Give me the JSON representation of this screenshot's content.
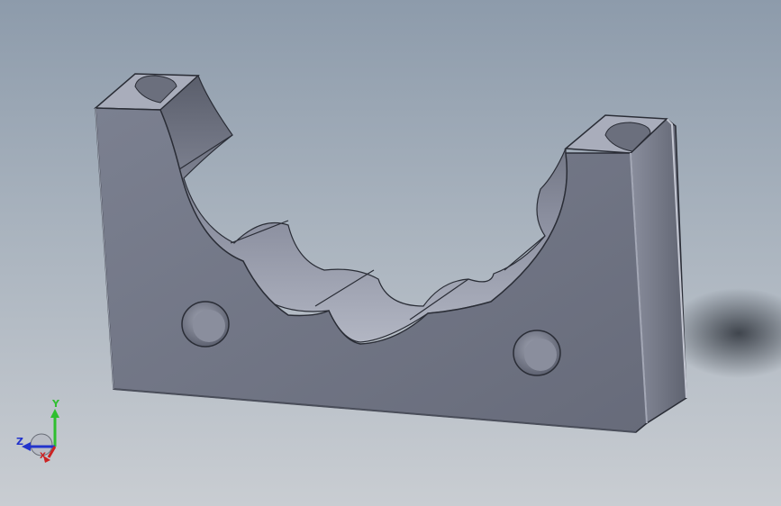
{
  "viewport": {
    "background_top": "#8d9bab",
    "background_bottom": "#c9cdd2",
    "model_face_color": "#6e7383",
    "model_edge_color": "#2a2d36",
    "model_highlight_color": "#a4a8b6"
  },
  "triad": {
    "y_label": "Y",
    "z_label": "Z",
    "x_label": "X",
    "y_color": "#2fbf2f",
    "z_color": "#2233cc",
    "x_color": "#cc2222"
  }
}
